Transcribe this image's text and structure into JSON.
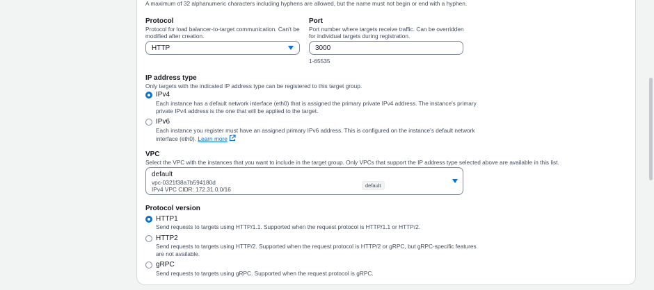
{
  "name_hint": "A maximum of 32 alphanumeric characters including hyphens are allowed, but the name must not begin or end with a hyphen.",
  "protocol": {
    "label": "Protocol",
    "description_line1": "Protocol for load balancer-to-target communication. Can't be",
    "description_line2": "modified after creation.",
    "value": "HTTP"
  },
  "port": {
    "label": "Port",
    "description_line1": "Port number where targets receive traffic. Can be overridden",
    "description_line2": "for individual targets during registration.",
    "value": "3000",
    "range_hint": "1-65535"
  },
  "ip_address_type": {
    "label": "IP address type",
    "description": "Only targets with the indicated IP address type can be registered to this target group.",
    "options": [
      {
        "label": "IPv4",
        "selected": true,
        "line1": "Each instance has a default network interface (eth0) that is assigned the primary private IPv4 address. The instance's primary",
        "line2": "private IPv4 address is the one that will be applied to the target."
      },
      {
        "label": "IPv6",
        "selected": false,
        "line1": "Each instance you register must have an assigned primary IPv6 address. This is configured on the instance's default network",
        "line2": "interface (eth0).",
        "link": "Learn more"
      }
    ]
  },
  "vpc": {
    "label": "VPC",
    "description": "Select the VPC with the instances that you want to include in the target group. Only VPCs that support the IP address type selected above are available in this list.",
    "name": "default",
    "id": "vpc-0321f38a7b594180d",
    "cidr": "IPv4 VPC CIDR: 172.31.0.0/16",
    "badge": "default"
  },
  "protocol_version": {
    "label": "Protocol version",
    "options": [
      {
        "label": "HTTP1",
        "selected": true,
        "line1": "Send requests to targets using HTTP/1.1. Supported when the request protocol is HTTP/1.1 or HTTP/2."
      },
      {
        "label": "HTTP2",
        "selected": false,
        "line1": "Send requests to targets using HTTP/2. Supported when the request protocol is HTTP/2 or gRPC, but gRPC-specific features",
        "line2": "are not available."
      },
      {
        "label": "gRPC",
        "selected": false,
        "line1": "Send requests to targets using gRPC. Supported when the request protocol is gRPC."
      }
    ]
  },
  "colors": {
    "accent": "#0972d3",
    "text": "#16191f",
    "secondary_text": "#414d5c",
    "border": "#7d8998"
  }
}
